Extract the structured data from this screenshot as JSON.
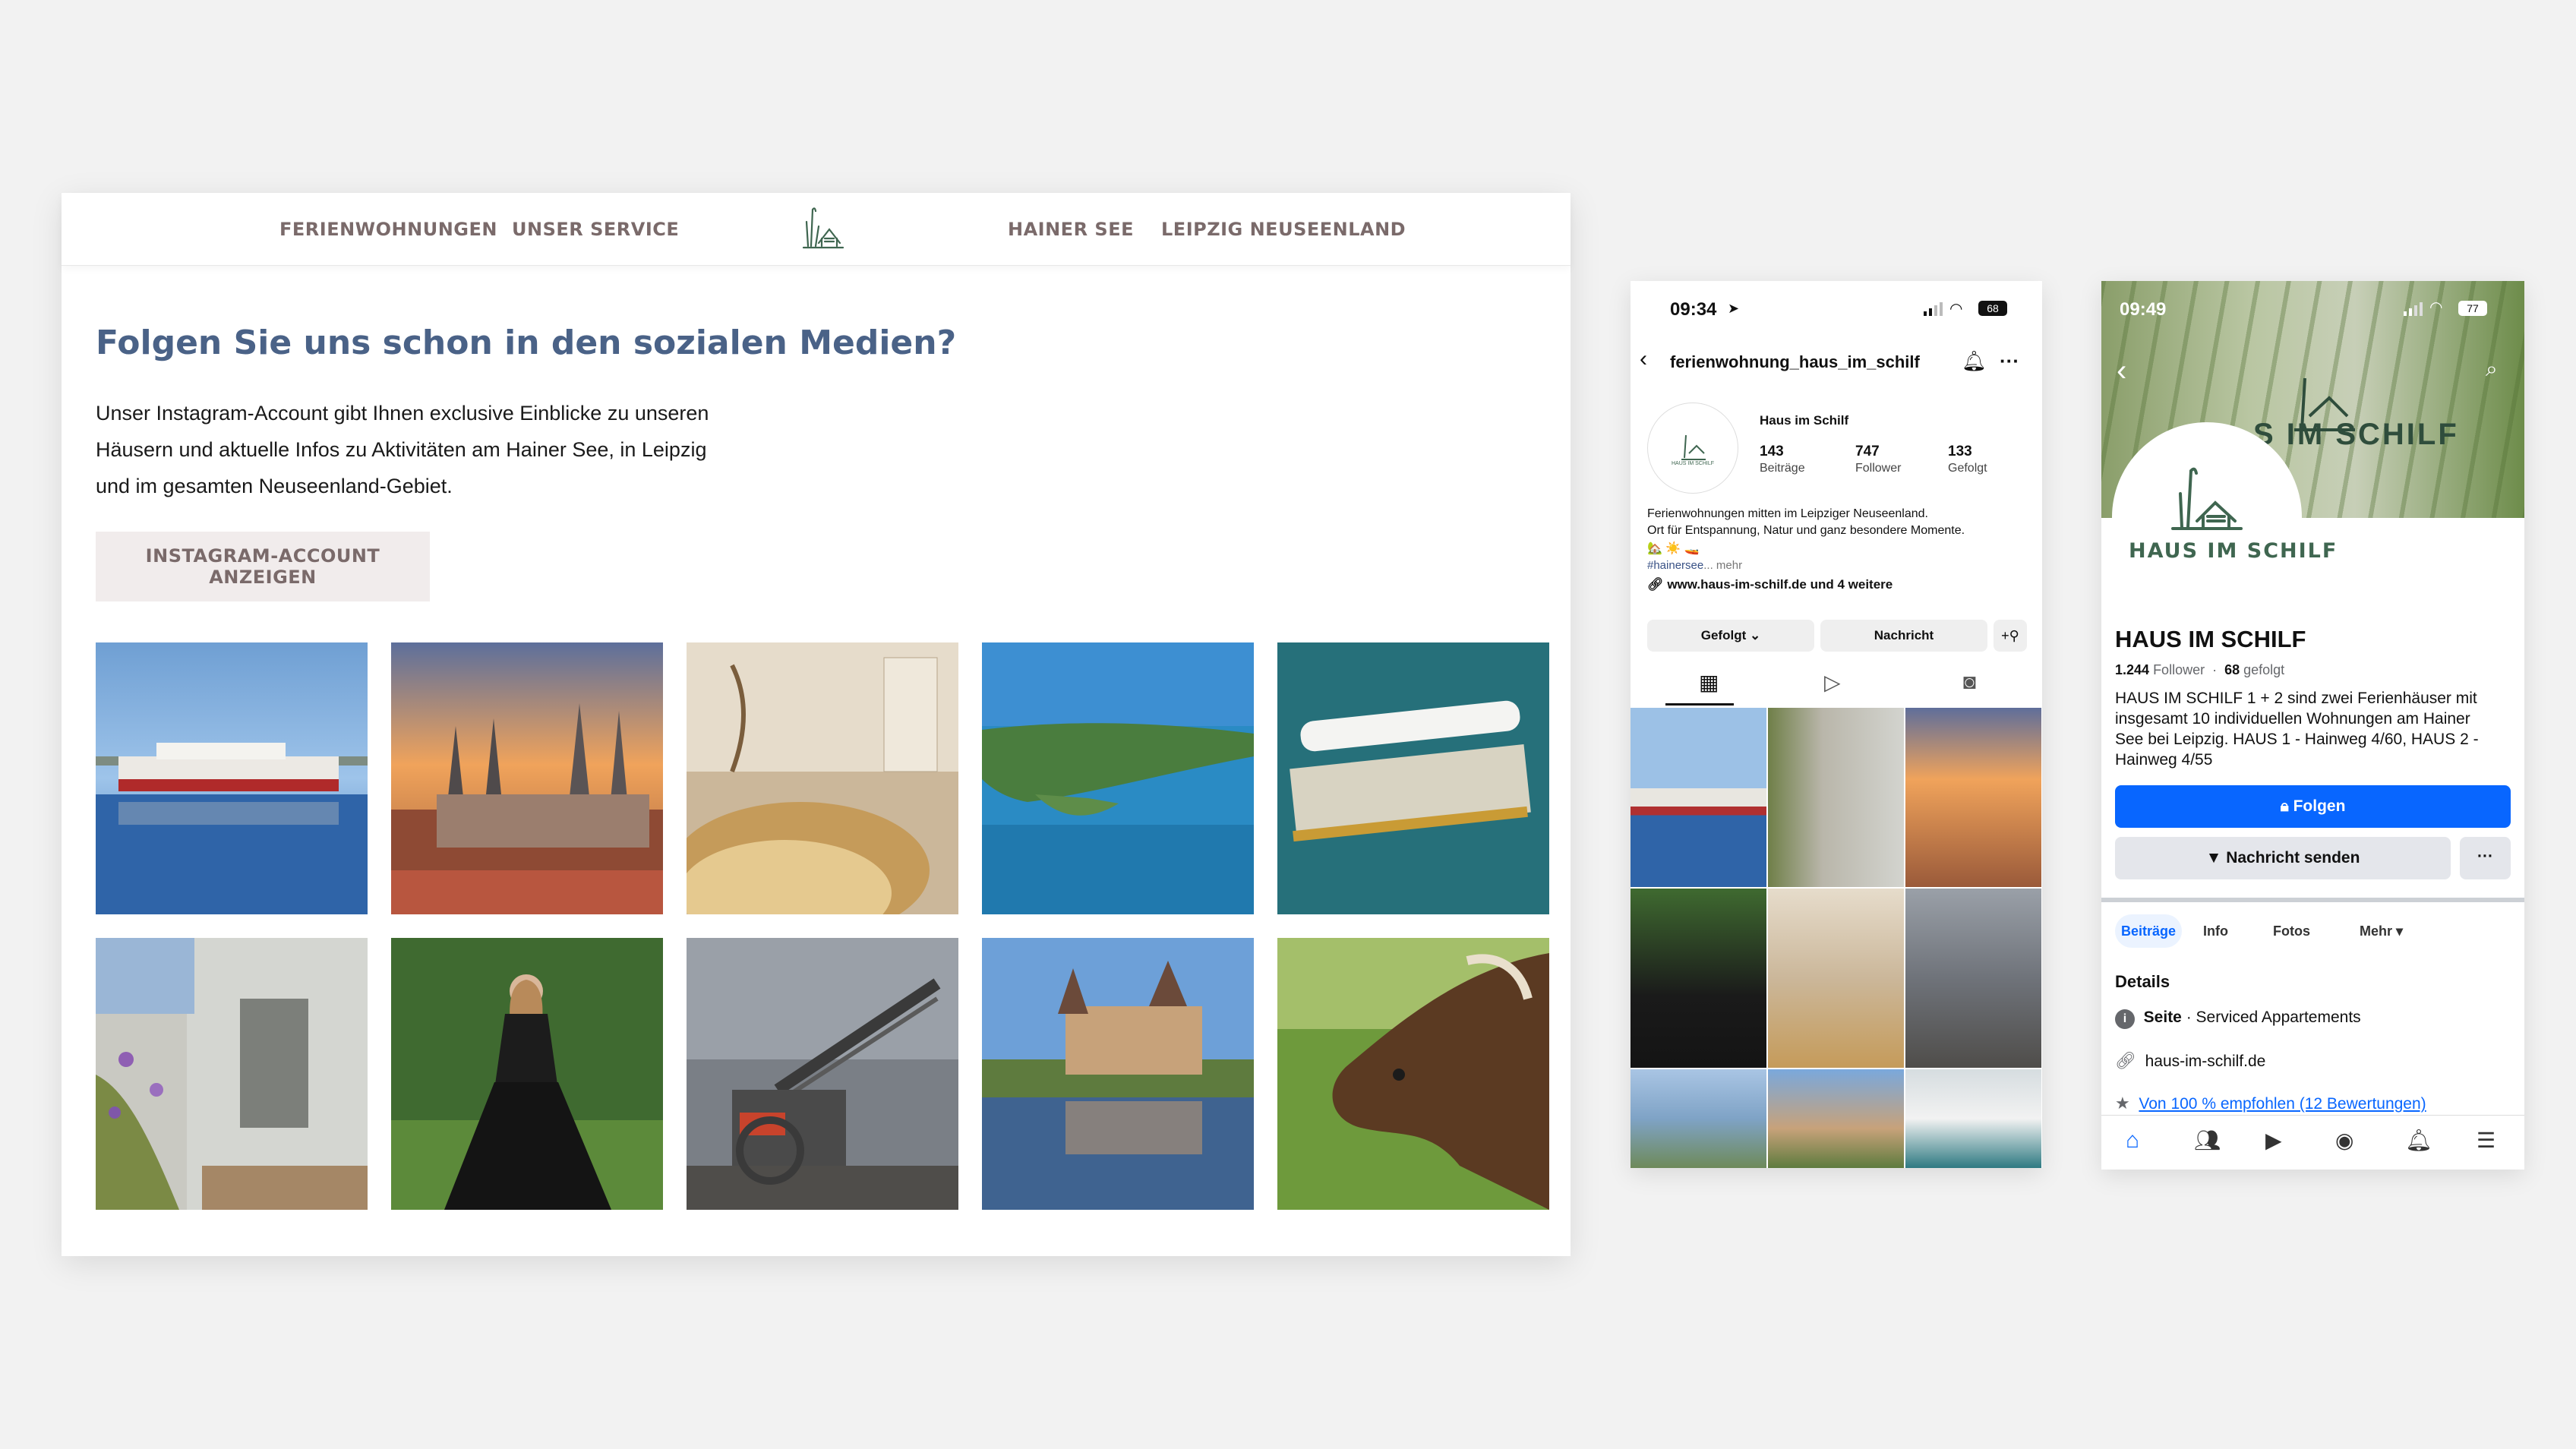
{
  "website": {
    "nav": {
      "left": [
        "FERIENWOHNUNGEN",
        "UNSER SERVICE"
      ],
      "right": [
        "HAINER SEE",
        "LEIPZIG NEUSEENLAND"
      ]
    },
    "heading": "Folgen Sie uns schon in den sozialen Medien?",
    "body_lines": [
      "Unser Instagram-Account gibt Ihnen exclusive Einblicke zu unseren",
      "Häusern und aktuelle Infos zu Aktivitäten am Hainer See, in Leipzig",
      "und im gesamten Neuseenland-Gebiet."
    ],
    "button": "INSTAGRAM-ACCOUNT ANZEIGEN",
    "photos": [
      "ferry-boat",
      "cathedral-town",
      "dining-table",
      "lake-aerial",
      "pontoon-boat",
      "house-terrace",
      "woman-in-gown",
      "mining-excavator",
      "castle-reflection",
      "bison"
    ]
  },
  "instagram": {
    "time": "09:34",
    "battery": "68",
    "username": "ferienwohnung_haus_im_schilf",
    "display_name": "Haus im Schilf",
    "avatar_text": "HAUS IM SCHILF",
    "stats": [
      {
        "value": "143",
        "label": "Beiträge"
      },
      {
        "value": "747",
        "label": "Follower"
      },
      {
        "value": "133",
        "label": "Gefolgt"
      }
    ],
    "bio_line1": "Ferienwohnungen mitten im Leipziger Neuseenland.",
    "bio_line2": "Ort für Entspannung, Natur und ganz besondere Momente.",
    "hashtag": "#hainersee",
    "more": "... mehr",
    "link": "www.haus-im-schilf.de und 4 weitere",
    "btn_following": "Gefolgt",
    "btn_message": "Nachricht"
  },
  "facebook": {
    "time": "09:49",
    "battery": "77",
    "cover_text": "S IM SCHILF",
    "logo_text": "HAUS IM SCHILF",
    "page_name": "HAUS IM SCHILF",
    "followers_count": "1.244",
    "followers_label": "Follower",
    "following_count": "68",
    "following_label": "gefolgt",
    "desc_lines": [
      "HAUS IM SCHILF 1 + 2 sind zwei Ferienhäuser mit",
      "insgesamt 10  individuellen Wohnungen am Hainer",
      "See bei Leipzig. HAUS 1 - Hainweg 4/60, HAUS 2 -",
      "Hainweg 4/55"
    ],
    "follow_btn": "Folgen",
    "message_btn": "Nachricht senden",
    "tabs": [
      "Beiträge",
      "Info",
      "Fotos",
      "Mehr"
    ],
    "details_title": "Details",
    "detail_page_bold": "Seite",
    "detail_page_rest": " · Serviced Appartements",
    "detail_web": "haus-im-schilf.de",
    "detail_rating": "Von 100 % empfohlen (12 Bewertungen)"
  },
  "colors": {
    "nav_text": "#7a6a6a",
    "heading": "#4a6287",
    "fb_blue": "#0866ff",
    "ig_link": "#385185",
    "logo_green": "#3f6650"
  }
}
